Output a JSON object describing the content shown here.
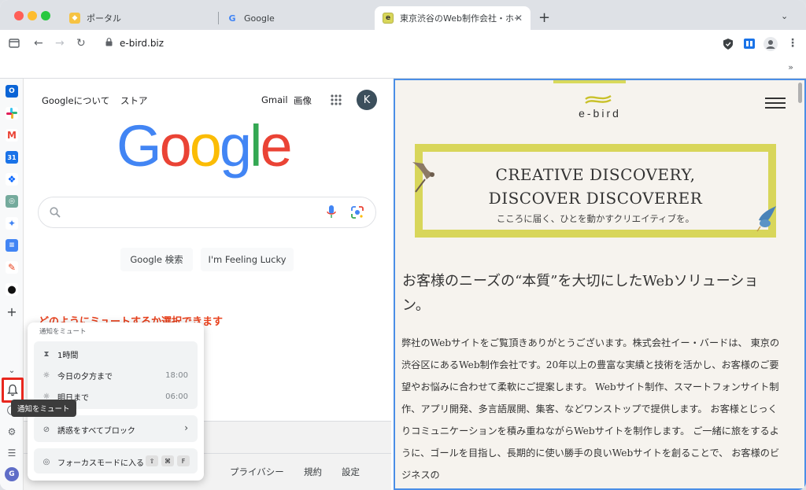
{
  "browser": {
    "tabs": [
      {
        "title": "ポータル"
      },
      {
        "title": "Google"
      },
      {
        "title": "東京渋谷のWeb制作会社・ホーム"
      }
    ],
    "url": "e-bird.biz",
    "bookmarks_more": "»"
  },
  "google": {
    "about": "Googleについて",
    "store": "ストア",
    "gmail": "Gmail",
    "images": "画像",
    "avatar_letter": "K",
    "logo": [
      "G",
      "o",
      "o",
      "g",
      "l",
      "e"
    ],
    "search_button": "Google 検索",
    "lucky_button": "I'm Feeling Lucky",
    "footer_privacy": "プライバシー",
    "footer_terms": "規約",
    "footer_settings": "設定"
  },
  "annotation": "どのようにミュートするか選択できます",
  "mute_menu": {
    "title": "通知をミュート",
    "options": [
      {
        "label": "1時間",
        "time": ""
      },
      {
        "label": "今日の夕方まで",
        "time": "18:00"
      },
      {
        "label": "明日まで",
        "time": "06:00"
      }
    ],
    "block_all": "誘惑をすべてブロック",
    "focus_mode": "フォーカスモードに入る",
    "shortcut": [
      "⇧",
      "⌘",
      "F"
    ]
  },
  "sidebar": {
    "tooltip": "通知をミュート",
    "profile_letter": "G"
  },
  "ebird": {
    "logo_text": "e-bird",
    "hero_line1": "CREATIVE DISCOVERY,",
    "hero_line2": "DISCOVER DISCOVERER",
    "hero_sub": "こころに届く、ひとを動かすクリエイティブを。",
    "heading": "お客様のニーズの“本質”を大切にしたWebソリューション。",
    "body": "弊社のWebサイトをご覧頂きありがとうございます。株式会社イー・バードは、 東京の渋谷区にあるWeb制作会社です。20年以上の豊富な実績と技術を活かし、お客様のご要望やお悩みに合わせて柔軟にご提案します。 Webサイト制作、スマートフォンサイト制作、アプリ開発、多言語展開、集客、などワンストップで提供します。 お客様とじっくりコミュニケーションを積み重ねながらWebサイトを制作します。 ご一緒に旅をするように、ゴールを目指し、長期的に使い勝手の良いWebサイトを創ることで、 お客様のビジネスの"
  },
  "colors": {
    "google_blue": "#4285F4",
    "google_red": "#EA4335",
    "google_yellow": "#FBBC05",
    "google_green": "#34A853",
    "annotation_red": "#e8401c",
    "ebird_yellow": "#d8d65a"
  }
}
